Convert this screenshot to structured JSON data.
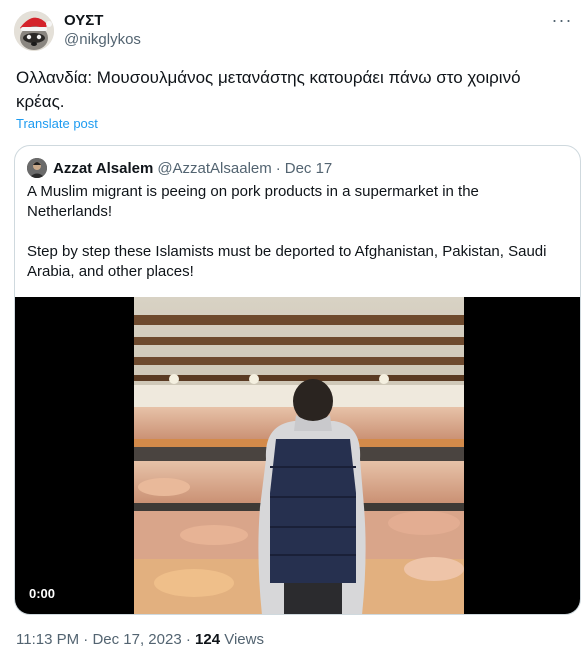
{
  "author": {
    "display_name": "ΟΥΣΤ",
    "handle": "@nikglykos",
    "avatar_icon": "raccoon-santa-hat-avatar"
  },
  "tweet": {
    "text": "Ολλανδία: Μουσουλμάνος μετανάστης κατουράει πάνω στο χοιρινό κρέας.",
    "translate_label": "Translate post"
  },
  "quoted": {
    "display_name": "Azzat Alsalem",
    "handle": "@AzzatAlsaalem",
    "separator": "·",
    "date": "Dec 17",
    "paragraph1": "A Muslim migrant is peeing on pork products in a supermarket in the Netherlands!",
    "paragraph2": "Step by step these Islamists must be deported to Afghanistan, Pakistan, Saudi Arabia, and other places!",
    "video": {
      "timestamp": "0:00"
    }
  },
  "footer": {
    "time": "11:13 PM",
    "separator1": "·",
    "date": "Dec 17, 2023",
    "separator2": "·",
    "views_count": "124",
    "views_label": "Views"
  },
  "colors": {
    "link": "#1d9bf0",
    "secondary_text": "#536471",
    "border": "#cfd9de"
  }
}
